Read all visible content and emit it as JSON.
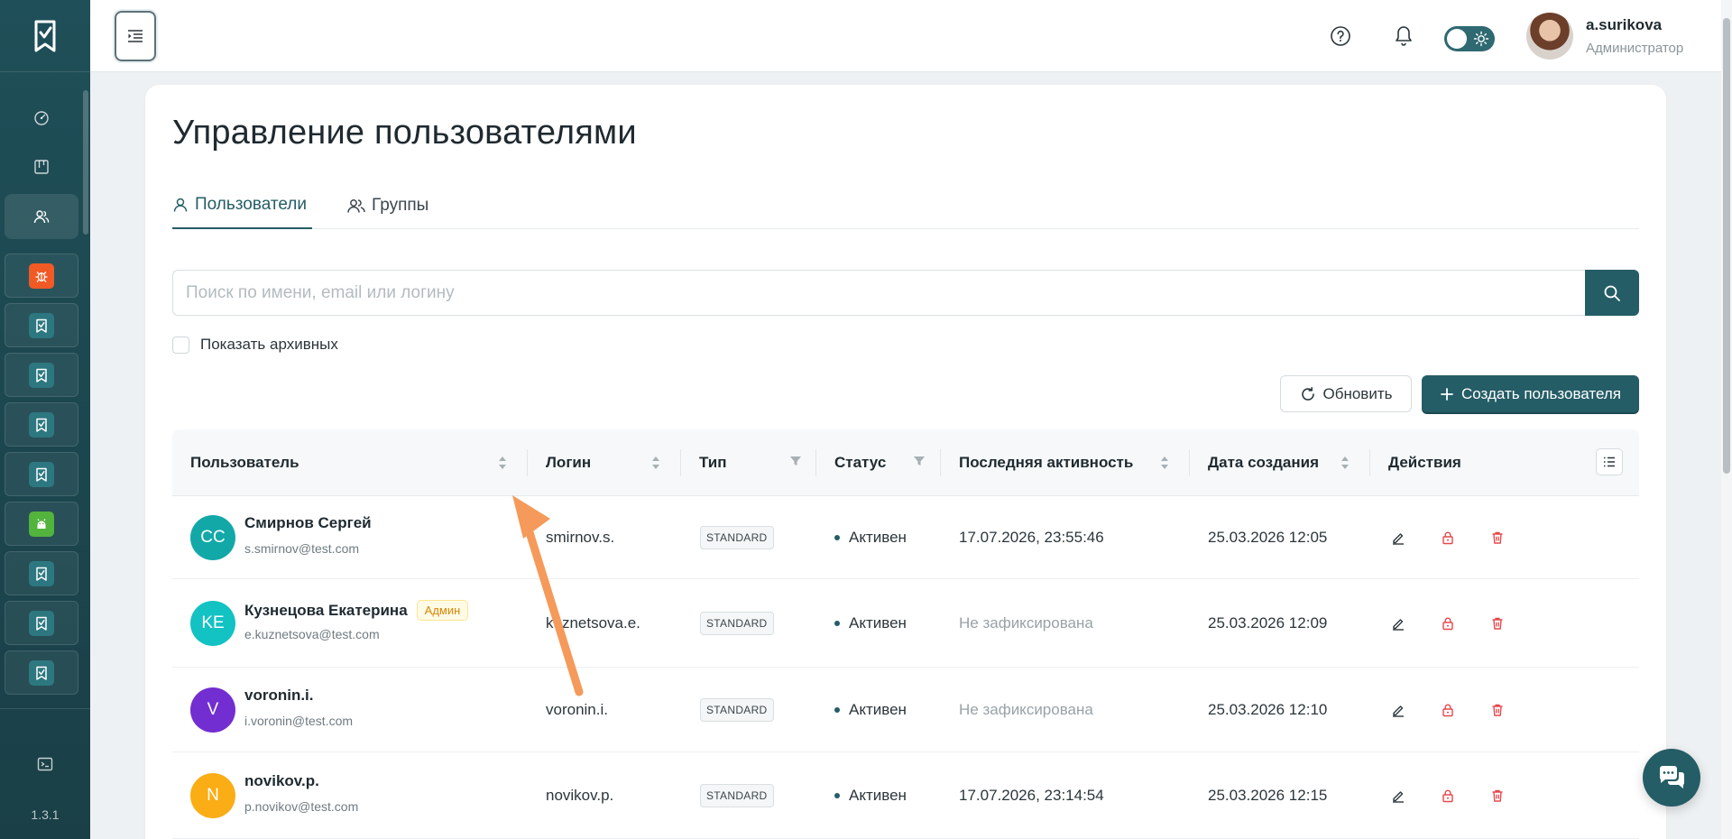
{
  "app": {
    "version": "1.3.1",
    "colors": {
      "primary": "#255d66",
      "sidebar": "#1f4f58",
      "danger": "#e5484d",
      "admin_badge": "#d48806"
    }
  },
  "sidebar": {
    "items": [
      {
        "icon": "dashboard-gauge-icon"
      },
      {
        "icon": "kanban-board-icon"
      },
      {
        "icon": "users-icon",
        "active": true
      }
    ],
    "apps": [
      {
        "icon": "bug-icon",
        "color": "#f15a24"
      },
      {
        "icon": "app-logo-icon",
        "color": "#2d7780"
      },
      {
        "icon": "app-logo-icon",
        "color": "#2d7780"
      },
      {
        "icon": "app-logo-icon",
        "color": "#2d7780"
      },
      {
        "icon": "app-logo-icon",
        "color": "#2d7780"
      },
      {
        "icon": "android-icon",
        "color": "#52b33d"
      },
      {
        "icon": "app-logo-icon",
        "color": "#2d7780"
      },
      {
        "icon": "app-logo-icon",
        "color": "#2d7780"
      },
      {
        "icon": "app-logo-icon",
        "color": "#2d7780"
      }
    ],
    "bottom_icon": "terminal-icon"
  },
  "header": {
    "user_name": "a.surikova",
    "user_role": "Администратор",
    "theme_mode": "light"
  },
  "page": {
    "title": "Управление пользователями",
    "tabs": [
      {
        "label": "Пользователи",
        "active": true
      },
      {
        "label": "Группы",
        "active": false
      }
    ],
    "search_placeholder": "Поиск по имени, email или логину",
    "search_value": "",
    "show_archived_label": "Показать архивных",
    "show_archived": false,
    "refresh_label": "Обновить",
    "create_label": "Создать пользователя"
  },
  "table": {
    "columns": [
      "Пользователь",
      "Логин",
      "Тип",
      "Статус",
      "Последняя активность",
      "Дата создания",
      "Действия"
    ],
    "rows": [
      {
        "initials": "СС",
        "avatar_color": "#13a8a8",
        "name": "Смирнов Сергей",
        "admin": false,
        "badge": "",
        "email": "s.smirnov@test.com",
        "login": "smirnov.s.",
        "type": "STANDARD",
        "status": "Активен",
        "last_activity": "17.07.2026, 23:55:46",
        "last_activity_muted": false,
        "created": "25.03.2026 12:05"
      },
      {
        "initials": "KE",
        "avatar_color": "#13c2c2",
        "name": "Кузнецова Екатерина",
        "admin": true,
        "badge": "Админ",
        "email": "e.kuznetsova@test.com",
        "login": "kuznetsova.e.",
        "type": "STANDARD",
        "status": "Активен",
        "last_activity": "Не зафиксирована",
        "last_activity_muted": true,
        "created": "25.03.2026 12:09"
      },
      {
        "initials": "V",
        "avatar_color": "#722ed1",
        "name": "voronin.i.",
        "admin": false,
        "badge": "",
        "email": "i.voronin@test.com",
        "login": "voronin.i.",
        "type": "STANDARD",
        "status": "Активен",
        "last_activity": "Не зафиксирована",
        "last_activity_muted": true,
        "created": "25.03.2026 12:10"
      },
      {
        "initials": "N",
        "avatar_color": "#faad14",
        "name": "novikov.p.",
        "admin": false,
        "badge": "",
        "email": "p.novikov@test.com",
        "login": "novikov.p.",
        "type": "STANDARD",
        "status": "Активен",
        "last_activity": "17.07.2026, 23:14:54",
        "last_activity_muted": false,
        "created": "25.03.2026 12:15"
      }
    ]
  }
}
